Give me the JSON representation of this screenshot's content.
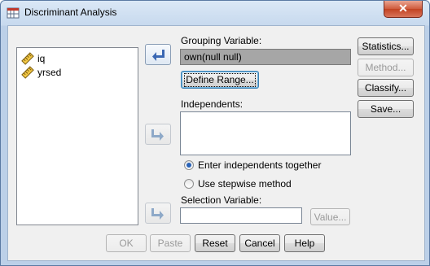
{
  "window": {
    "title": "Discriminant Analysis",
    "close_label": "✕"
  },
  "variables": [
    {
      "label": "iq",
      "icon": "scale-variable-icon"
    },
    {
      "label": "yrsed",
      "icon": "scale-variable-icon"
    }
  ],
  "grouping": {
    "label": "Grouping Variable:",
    "value": "own(null null)",
    "define_range": "Define Range..."
  },
  "independents": {
    "label": "Independents:"
  },
  "method": {
    "options": [
      {
        "label": "Enter independents together",
        "selected": true
      },
      {
        "label": "Use stepwise method",
        "selected": false
      }
    ]
  },
  "selection": {
    "label": "Selection Variable:",
    "value_button": "Value..."
  },
  "side_buttons": {
    "statistics": "Statistics...",
    "method": "Method...",
    "classify": "Classify...",
    "save": "Save..."
  },
  "bottom_buttons": {
    "ok": "OK",
    "paste": "Paste",
    "reset": "Reset",
    "cancel": "Cancel",
    "help": "Help"
  },
  "colors": {
    "active_arrow": "#3a67b3",
    "disabled_arrow": "#8ea9c8"
  }
}
